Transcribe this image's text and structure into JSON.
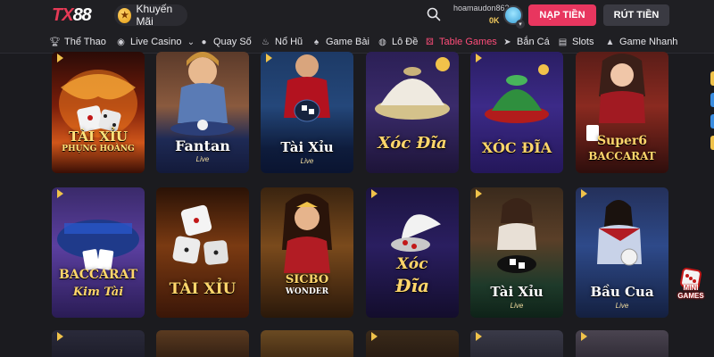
{
  "header": {
    "logo_tx": "TX",
    "logo_num": "88",
    "promo_label": "Khuyến Mãi",
    "username": "hoamaudon862",
    "balance": "0K",
    "deposit_label": "NẠP TIỀN",
    "withdraw_label": "RÚT TIỀN"
  },
  "nav": {
    "items": [
      {
        "label": "Thể Thao",
        "icon": "trophy-icon"
      },
      {
        "label": "Live Casino",
        "icon": "live-icon"
      },
      {
        "label": "Quay Số",
        "icon": "lottery-ball-icon"
      },
      {
        "label": "Nổ Hũ",
        "icon": "slot-jar-icon"
      },
      {
        "label": "Game Bài",
        "icon": "cards-icon"
      },
      {
        "label": "Lô Đề",
        "icon": "number-ball-icon"
      },
      {
        "label": "Table Games",
        "icon": "dice-icon",
        "active": true
      },
      {
        "label": "Bắn Cá",
        "icon": "fish-icon"
      },
      {
        "label": "Slots",
        "icon": "slot-machine-icon"
      },
      {
        "label": "Game Nhanh",
        "icon": "rocket-icon"
      }
    ]
  },
  "games": [
    {
      "title_line1": "TÀI XỈU",
      "title_line2": "PHỤNG HOÀNG",
      "sub": ""
    },
    {
      "title_line1": "Fantan",
      "title_line2": "",
      "sub": "Live"
    },
    {
      "title_line1": "Tài Xỉu",
      "title_line2": "",
      "sub": "Live"
    },
    {
      "title_line1": "Xóc Đĩa",
      "title_line2": "",
      "sub": ""
    },
    {
      "title_line1": "XÓC ĐĨA",
      "title_line2": "",
      "sub": ""
    },
    {
      "title_line1": "Super6",
      "title_line2": "BACCARAT",
      "sub": ""
    },
    {
      "title_line1": "BACCARAT",
      "title_line2": "Kim Tài",
      "sub": ""
    },
    {
      "title_line1": "TÀI XỈU",
      "title_line2": "",
      "sub": ""
    },
    {
      "title_line1": "SICBO",
      "title_line2": "WONDER",
      "sub": ""
    },
    {
      "title_line1": "Xóc",
      "title_line2": "Đĩa",
      "sub": ""
    },
    {
      "title_line1": "Tài Xỉu",
      "title_line2": "",
      "sub": "Live"
    },
    {
      "title_line1": "Bầu Cua",
      "title_line2": "",
      "sub": "Live"
    }
  ],
  "mini_games": {
    "line1": "MINI",
    "line2": "GAMES"
  },
  "colors": {
    "background": "#1b1b1f",
    "header": "#1f1f23",
    "accent": "#e8365f",
    "active_nav": "#ff4d7a",
    "balance": "#f0c85c"
  }
}
